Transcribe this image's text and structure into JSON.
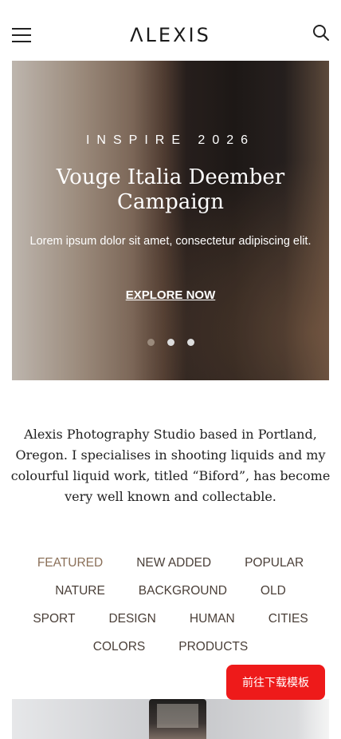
{
  "header": {
    "logo": "ΛLEXIS",
    "menu_icon": "hamburger-menu-icon",
    "search_icon": "search-icon"
  },
  "hero": {
    "eyebrow": "INSPIRE 2026",
    "title": "Vouge Italia Deember Campaign",
    "text": "Lorem ipsum dolor sit amet, consectetur adipiscing elit.",
    "cta": "EXPLORE NOW",
    "slide_count": 3,
    "active_slide": 1
  },
  "about": {
    "text": "Alexis Photography Studio based in Portland, Oregon. I specialises in shooting liquids and my colourful liquid work, titled “Biford”, has become very well known and collectable."
  },
  "filters": [
    "FEATURED",
    "NEW ADDED",
    "POPULAR",
    "NATURE",
    "BACKGROUND",
    "OLD",
    "SPORT",
    "DESIGN",
    "HUMAN",
    "CITIES",
    "COLORS",
    "PRODUCTS"
  ],
  "active_filter": "FEATURED",
  "download_button": "前往下载模板",
  "colors": {
    "accent": "#8a6f58",
    "download_bg": "#ee1a1a"
  }
}
